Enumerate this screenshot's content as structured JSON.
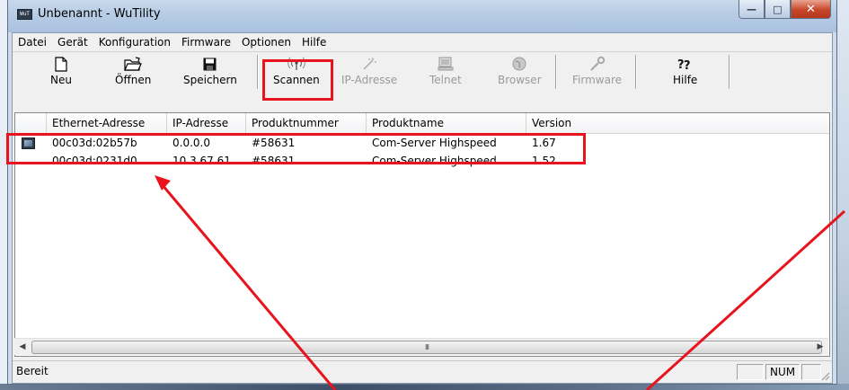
{
  "window": {
    "title": "Unbenannt - WuTility",
    "app_icon_text": "WuT",
    "minimize_glyph": "—",
    "maximize_glyph": "□",
    "close_glyph": "✕"
  },
  "menu": [
    "Datei",
    "Gerät",
    "Konfiguration",
    "Firmware",
    "Optionen",
    "Hilfe"
  ],
  "toolbar": {
    "neu": "Neu",
    "oeffnen": "Öffnen",
    "speichern": "Speichern",
    "scannen": "Scannen",
    "ip_adresse": "IP-Adresse",
    "telnet": "Telnet",
    "browser": "Browser",
    "firmware": "Firmware",
    "hilfe": "Hilfe"
  },
  "table": {
    "columns": [
      "Ethernet-Adresse",
      "IP-Adresse",
      "Produktnummer",
      "Produktname",
      "Version"
    ],
    "rows": [
      [
        "00c03d:02b57b",
        "0.0.0.0",
        "#58631",
        "Com-Server Highspeed",
        "1.67"
      ],
      [
        "00c03d:0231d0",
        "10.3.67.61",
        "#58631",
        "Com-Server Highspeed",
        "1.52"
      ]
    ]
  },
  "scrollbar": {
    "left_glyph": "◀",
    "right_glyph": "▶",
    "thumb_grip": "III"
  },
  "status": {
    "text": "Bereit",
    "num": "NUM"
  },
  "colors": {
    "annotation_red": "#e8131c"
  }
}
